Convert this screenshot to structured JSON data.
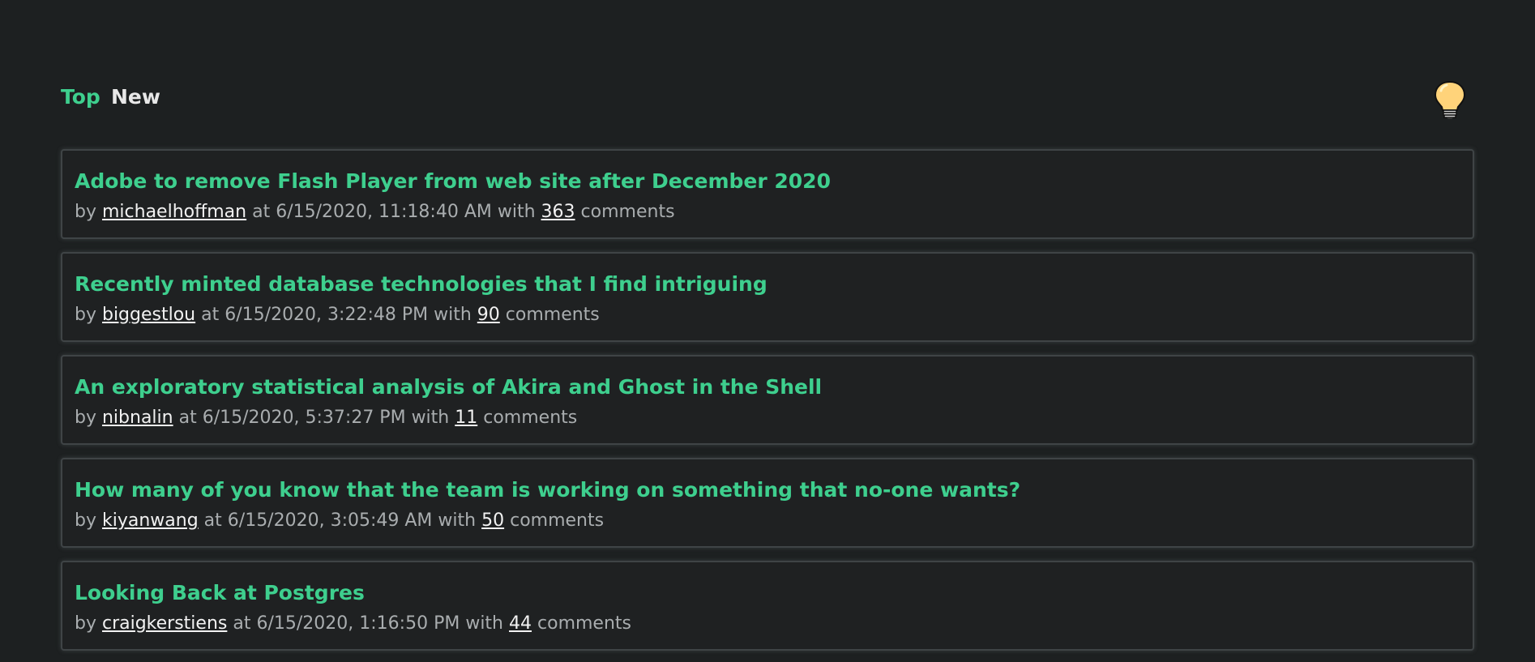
{
  "nav": {
    "tabs": [
      {
        "label": "Top",
        "active": true
      },
      {
        "label": "New",
        "active": false
      }
    ],
    "theme_icon": "lightbulb-icon"
  },
  "colors": {
    "background": "#1d2021",
    "accent": "#3ecf8e",
    "card_border": "#3f4446",
    "meta_text": "#a9adaf",
    "link_text": "#f2f2f2"
  },
  "labels": {
    "by": "by",
    "at": "at",
    "with": "with",
    "comments": "comments"
  },
  "stories": [
    {
      "title": "Adobe to remove Flash Player from web site after December 2020",
      "author": "michaelhoffman",
      "time": "6/15/2020, 11:18:40 AM",
      "comments": "363"
    },
    {
      "title": "Recently minted database technologies that I find intriguing",
      "author": "biggestlou",
      "time": "6/15/2020, 3:22:48 PM",
      "comments": "90"
    },
    {
      "title": "An exploratory statistical analysis of Akira and Ghost in the Shell",
      "author": "nibnalin",
      "time": "6/15/2020, 5:37:27 PM",
      "comments": "11"
    },
    {
      "title": "How many of you know that the team is working on something that no-one wants?",
      "author": "kiyanwang",
      "time": "6/15/2020, 3:05:49 AM",
      "comments": "50"
    },
    {
      "title": "Looking Back at Postgres",
      "author": "craigkerstiens",
      "time": "6/15/2020, 1:16:50 PM",
      "comments": "44"
    }
  ]
}
